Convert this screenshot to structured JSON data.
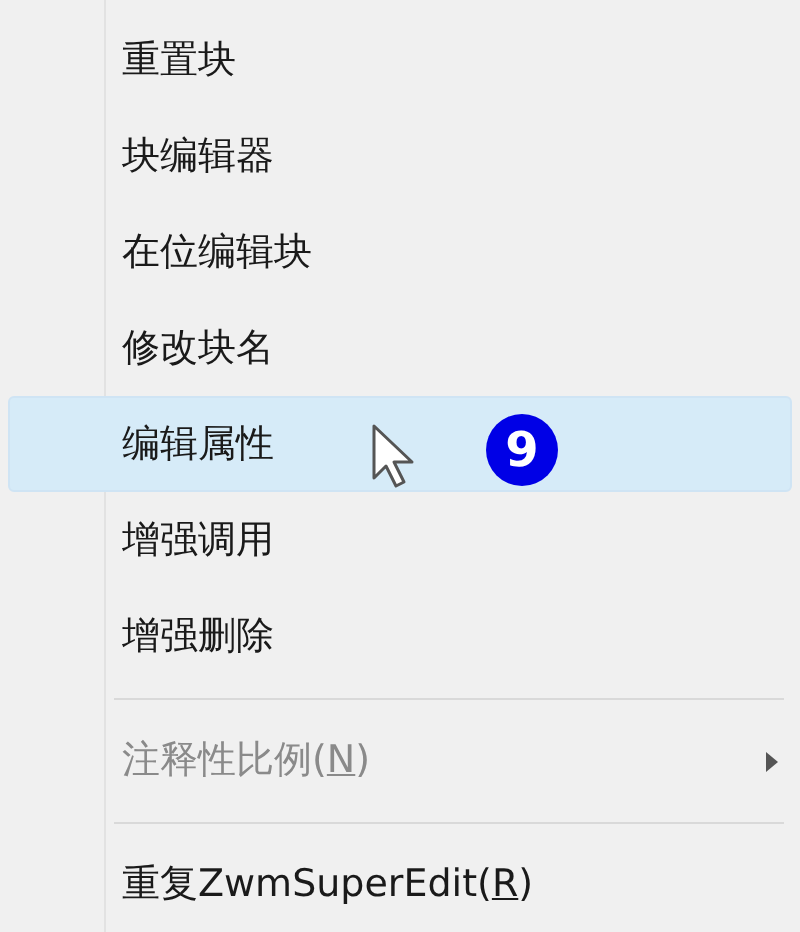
{
  "menu": {
    "items": [
      {
        "kind": "item",
        "before": "重置块",
        "selected": false,
        "disabled": false
      },
      {
        "kind": "item",
        "before": "块编辑器",
        "selected": false,
        "disabled": false
      },
      {
        "kind": "item",
        "before": "在位编辑块",
        "selected": false,
        "disabled": false
      },
      {
        "kind": "item",
        "before": "修改块名",
        "selected": false,
        "disabled": false
      },
      {
        "kind": "item",
        "before": "编辑属性",
        "selected": true,
        "disabled": false,
        "callout": "9"
      },
      {
        "kind": "item",
        "before": "增强调用",
        "selected": false,
        "disabled": false
      },
      {
        "kind": "item",
        "before": "增强删除",
        "selected": false,
        "disabled": false
      },
      {
        "kind": "separator"
      },
      {
        "kind": "item",
        "before": "注释性比例(",
        "mnemonic": "N",
        "after": ")",
        "selected": false,
        "disabled": true,
        "submenu": true
      },
      {
        "kind": "separator"
      },
      {
        "kind": "item",
        "before": "重复ZwmSuperEdit(",
        "mnemonic": "R",
        "after": ")",
        "selected": false,
        "disabled": false
      }
    ]
  }
}
